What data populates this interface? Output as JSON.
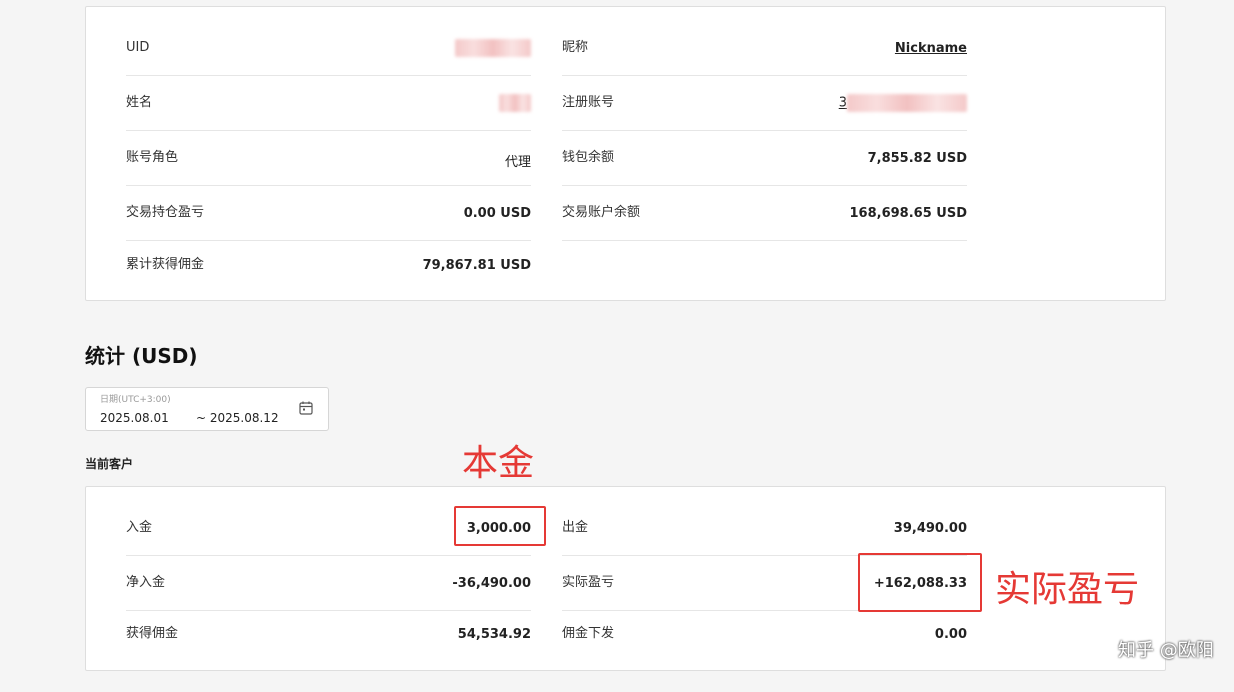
{
  "profile": {
    "uid_label": "UID",
    "nickname_label": "昵称",
    "nickname_value": "Nickname",
    "name_label": "姓名",
    "reg_account_label": "注册账号",
    "reg_account_prefix": "3",
    "role_label": "账号角色",
    "role_value": "代理",
    "wallet_label": "钱包余额",
    "wallet_value": "7,855.82 USD",
    "position_pnl_label": "交易持仓盈亏",
    "position_pnl_value": "0.00 USD",
    "trade_balance_label": "交易账户余额",
    "trade_balance_value": "168,698.65 USD",
    "commission_total_label": "累计获得佣金",
    "commission_total_value": "79,867.81 USD"
  },
  "stats": {
    "title": "统计 (USD)",
    "date_label": "日期(UTC+3:00)",
    "date_start": "2025.08.01",
    "date_end": "~ 2025.08.12",
    "current_clients_label": "当前客户"
  },
  "clients": {
    "deposit_label": "入金",
    "deposit_value": "3,000.00",
    "withdraw_label": "出金",
    "withdraw_value": "39,490.00",
    "net_deposit_label": "净入金",
    "net_deposit_value": "-36,490.00",
    "realized_pnl_label": "实际盈亏",
    "realized_pnl_value": "+162,088.33",
    "commission_label": "获得佣金",
    "commission_value": "54,534.92",
    "commission_payout_label": "佣金下发",
    "commission_payout_value": "0.00"
  },
  "annotations": {
    "principal": "本金",
    "actual_pnl": "实际盈亏"
  },
  "watermark": "知乎 @欧阳",
  "colors": {
    "annotation_red": "#e53935",
    "positive_green": "#3aa655",
    "link_red": "#c0392b"
  }
}
